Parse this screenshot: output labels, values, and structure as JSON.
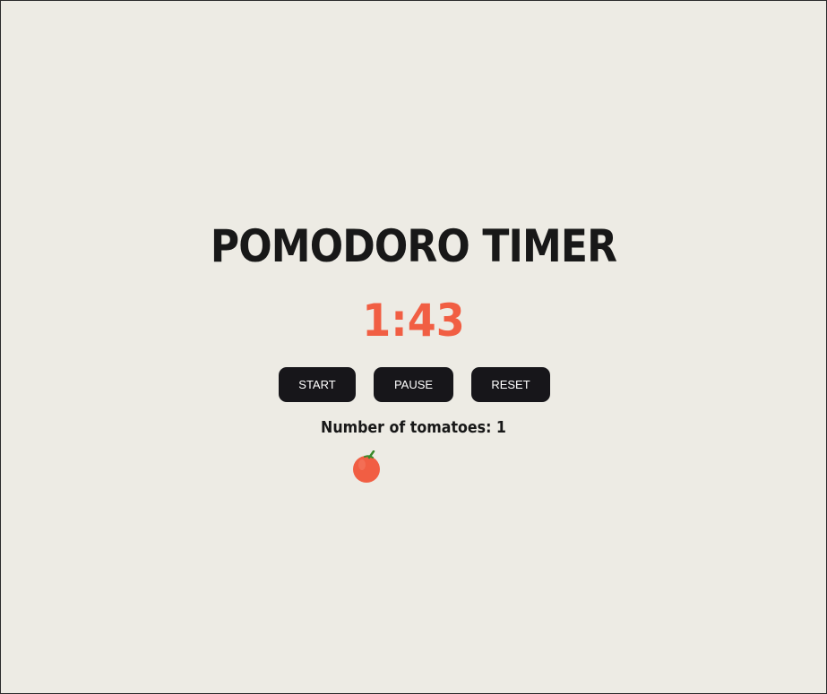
{
  "app": {
    "title": "POMODORO TIMER",
    "timer_display": "1:43"
  },
  "controls": {
    "start_label": "START",
    "pause_label": "PAUSE",
    "reset_label": "RESET"
  },
  "tomatoes": {
    "label": "Number of tomatoes: 1",
    "count": 1,
    "icons": [
      "tomato-icon"
    ]
  },
  "colors": {
    "background": "#edebe4",
    "title": "#181818",
    "timer": "#f15e43",
    "button_bg": "#17161a",
    "button_text": "#ffffff",
    "tomato": "#f15e43",
    "stem": "#3a8a2a"
  }
}
